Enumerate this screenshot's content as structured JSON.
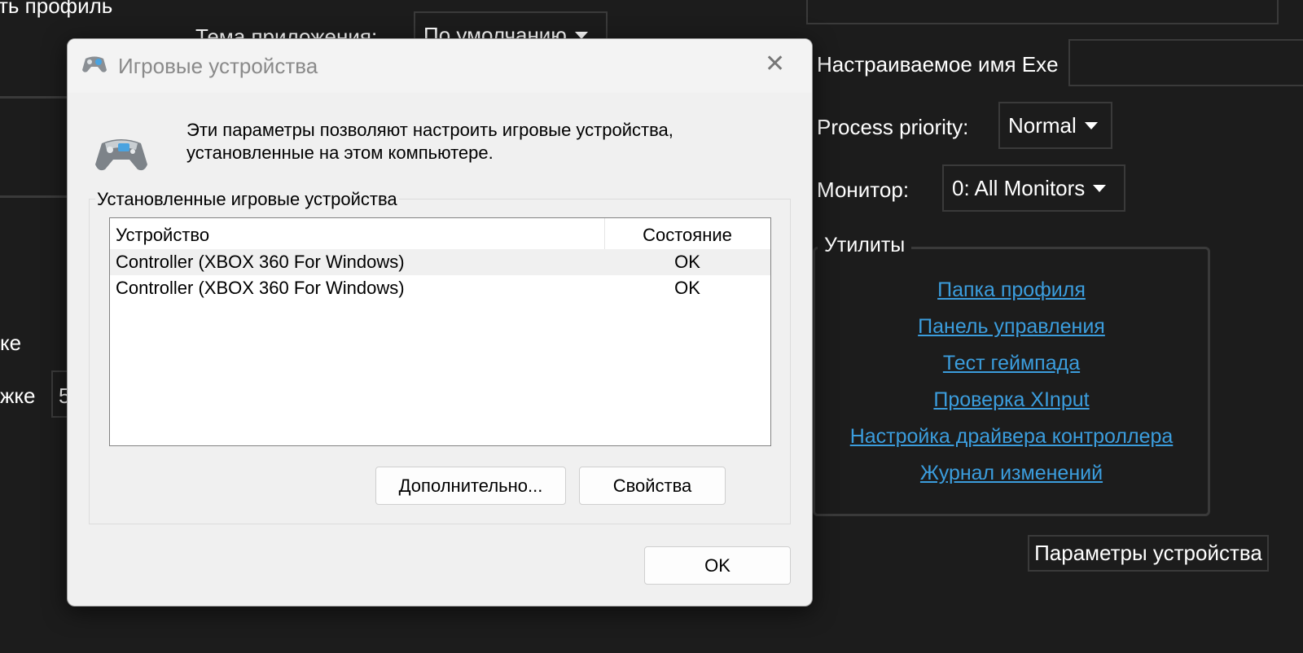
{
  "background_app": {
    "profile_text": "ть профиль",
    "theme_label": "Тема приложения:",
    "theme_value": "По умолчанию",
    "exe_label": "Настраиваемое имя Exe",
    "exe_value": "",
    "priority_label": "Process priority:",
    "priority_value": "Normal",
    "monitor_label": "Монитор:",
    "monitor_value": "0: All Monitors",
    "partial_label_1": "ке",
    "partial_label_2": "жке",
    "partial_value": "5",
    "utilities": {
      "legend": "Утилиты",
      "links": [
        "Папка профиля",
        "Панель управления",
        "Тест геймпада",
        "Проверка XInput",
        "Настройка драйвера контроллера",
        "Журнал изменений"
      ]
    },
    "device_params_button": "Параметры устройства",
    "link_color": "#3b9ddd"
  },
  "dialog": {
    "title": "Игровые устройства",
    "close_icon": "close-icon",
    "gamepad_icon": "gamepad-icon",
    "description_line1": "Эти параметры позволяют настроить игровые устройства,",
    "description_line2": "установленные на этом компьютере.",
    "group_label": "Установленные игровые устройства",
    "columns": [
      "Устройство",
      "Состояние"
    ],
    "rows": [
      {
        "device": "Controller (XBOX 360 For Windows)",
        "status": "OK"
      },
      {
        "device": "Controller (XBOX 360 For Windows)",
        "status": "OK"
      }
    ],
    "advanced_button": "Дополнительно...",
    "properties_button": "Свойства",
    "ok_button": "OK"
  }
}
